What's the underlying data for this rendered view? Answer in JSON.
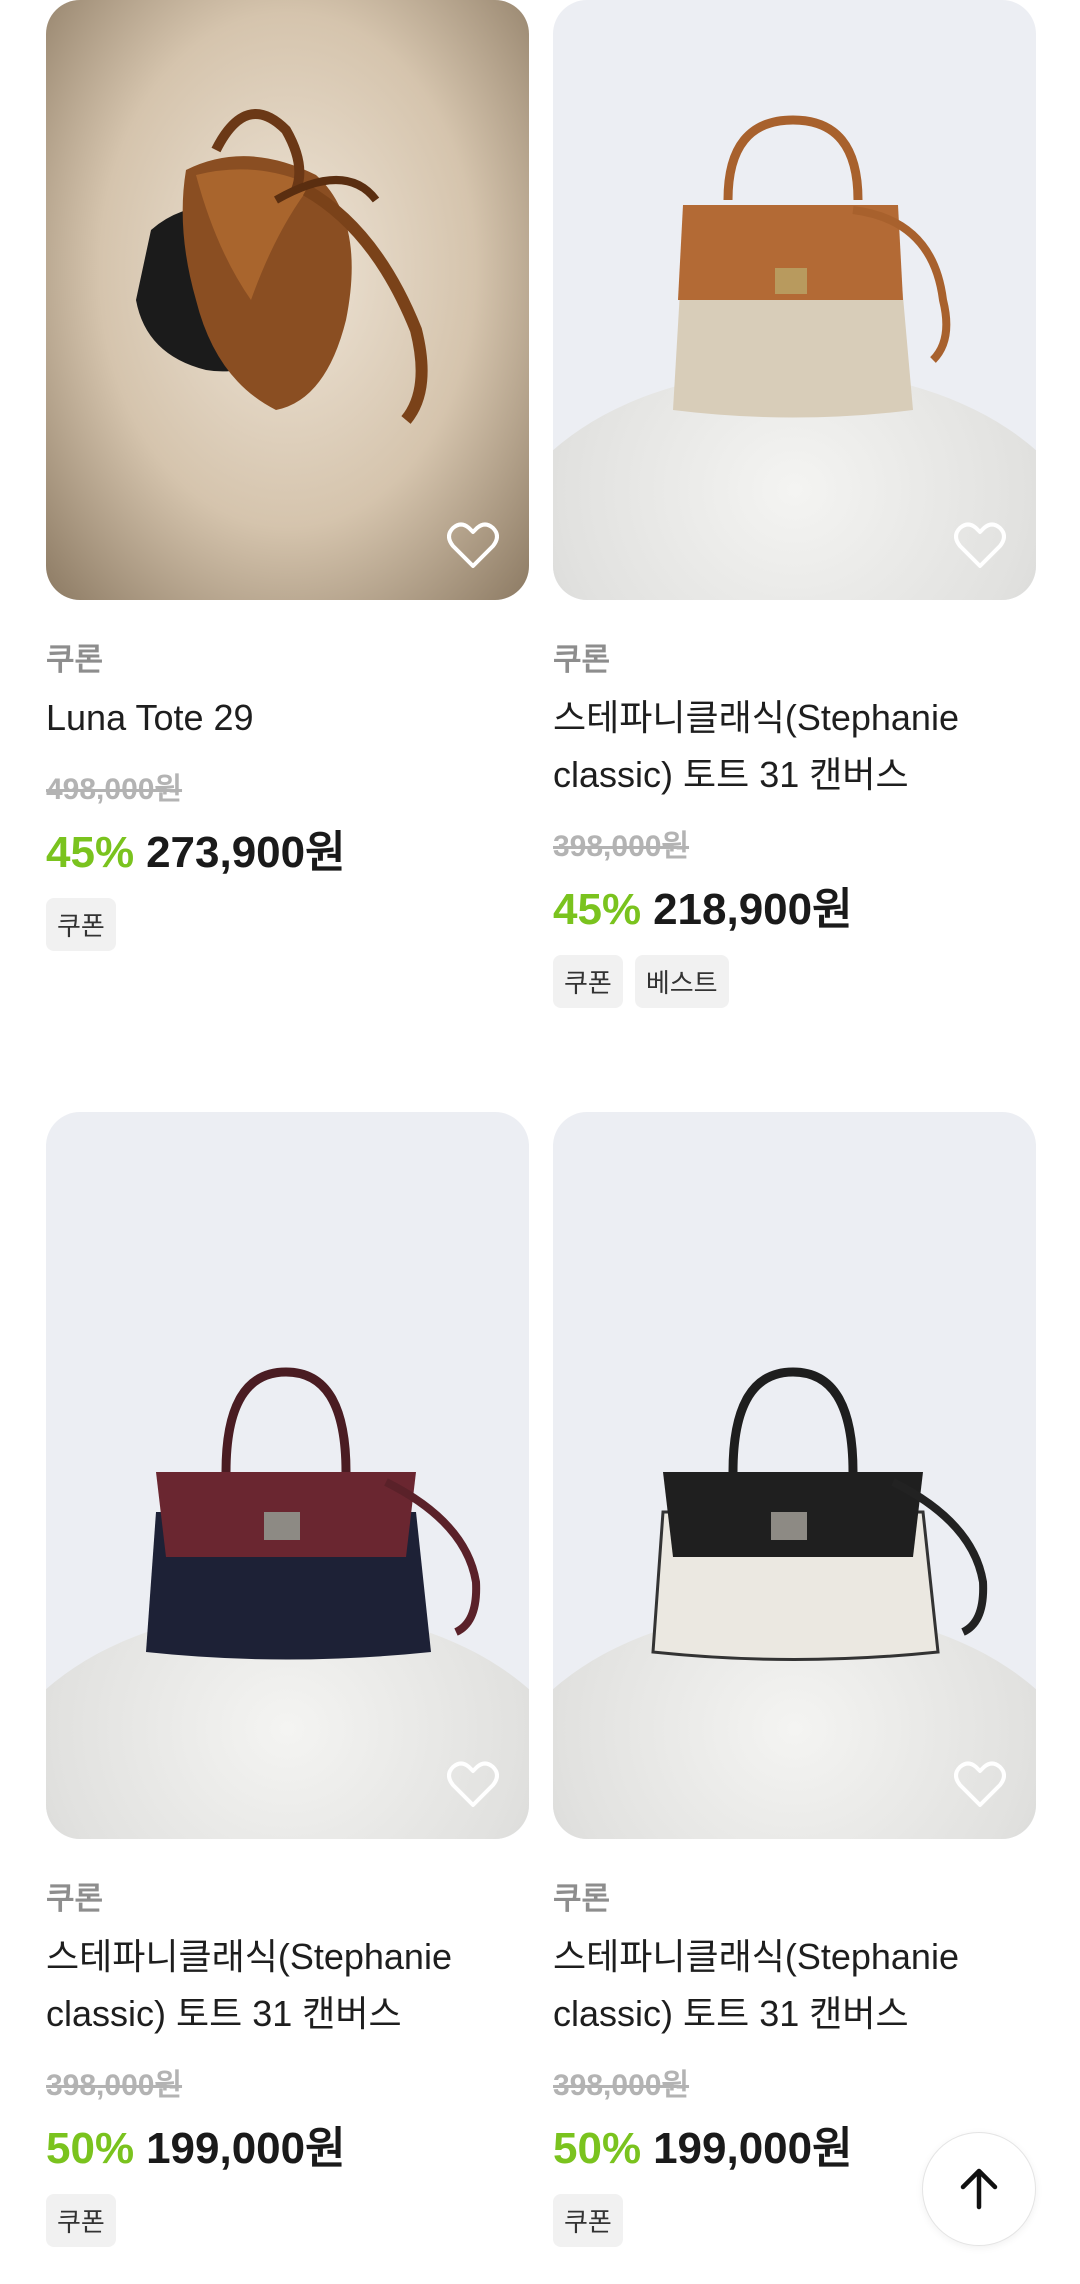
{
  "products": [
    {
      "brand": "쿠론",
      "name": "Luna Tote 29",
      "original_price": "498,000원",
      "discount": "45%",
      "price": "273,900원",
      "tags": [
        "쿠폰"
      ],
      "image_icon": "brown-leather-tote-photo",
      "bg_color": "#c6b39c"
    },
    {
      "brand": "쿠론",
      "name": "스테파니클래식(Stephanie classic) 토트 31 캔버스",
      "original_price": "398,000원",
      "discount": "45%",
      "price": "218,900원",
      "tags": [
        "쿠폰",
        "베스트"
      ],
      "image_icon": "beige-canvas-handbag-photo",
      "bg_color": "#eceef3"
    },
    {
      "brand": "쿠론",
      "name": "스테파니클래식(Stephanie classic) 토트 31 캔버스",
      "original_price": "398,000원",
      "discount": "50%",
      "price": "199,000원",
      "tags": [
        "쿠폰"
      ],
      "image_icon": "navy-burgundy-handbag-photo",
      "bg_color": "#eceef3"
    },
    {
      "brand": "쿠론",
      "name": "스테파니클래식(Stephanie classic) 토트 31 캔버스",
      "original_price": "398,000원",
      "discount": "50%",
      "price": "199,000원",
      "tags": [
        "쿠폰"
      ],
      "image_icon": "black-white-handbag-photo",
      "bg_color": "#eceef3"
    }
  ],
  "icons": {
    "wishlist": "heart-icon",
    "scroll_top": "arrow-up-icon"
  },
  "colors": {
    "discount": "#7ac31e",
    "strikethrough": "#b3b3b3",
    "brand": "#8d8d8d"
  }
}
